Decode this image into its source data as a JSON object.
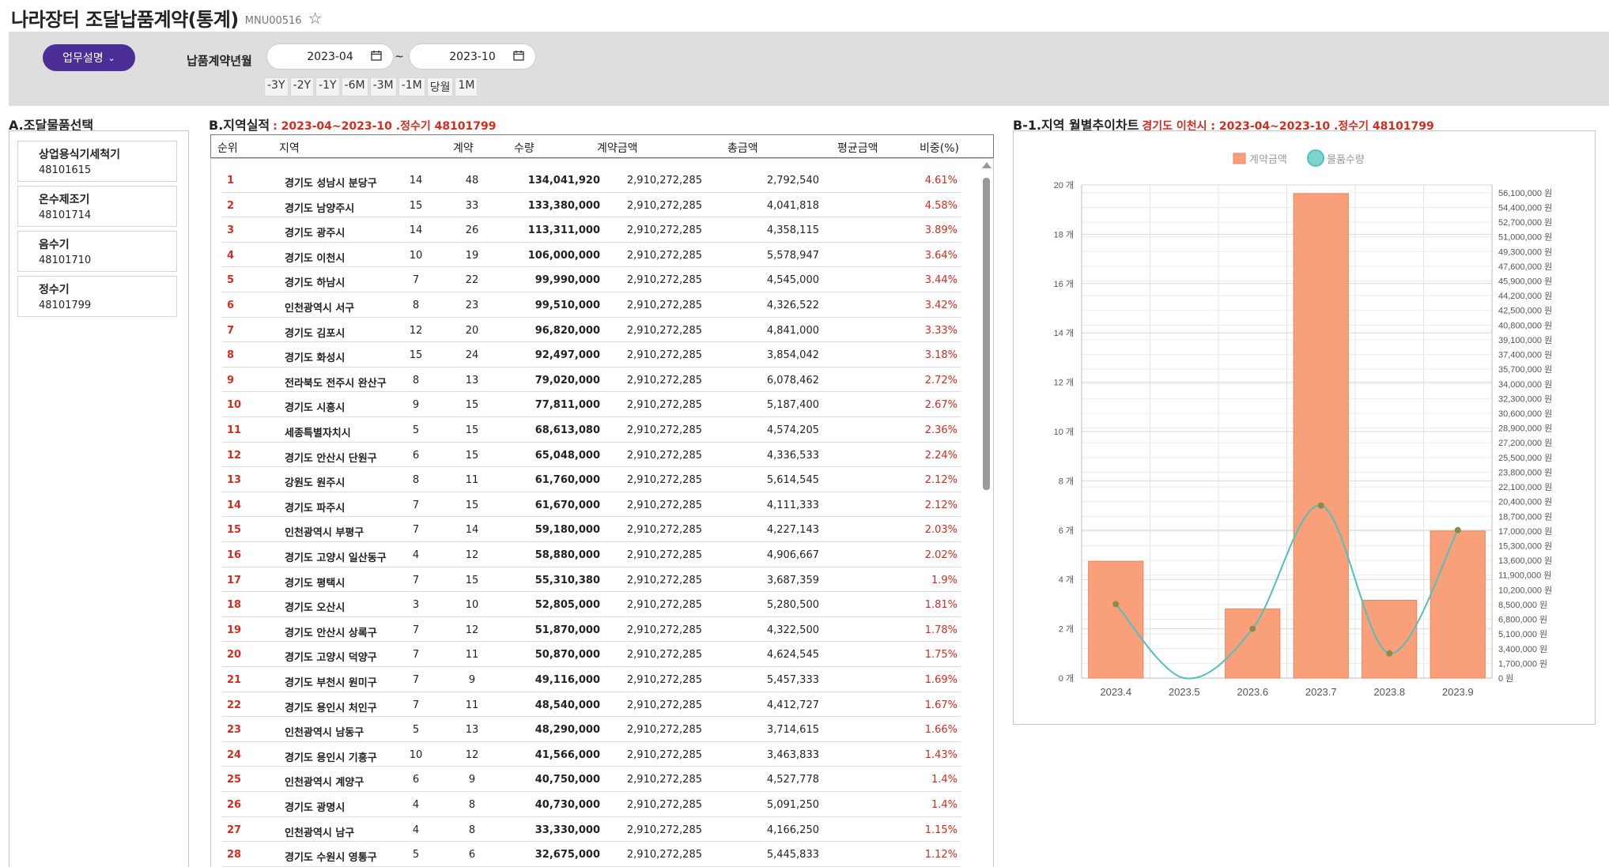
{
  "header": {
    "title": "나라장터 조달납품계약(통계)",
    "code": "MNU00516",
    "star_icon": "star-outline-icon"
  },
  "search": {
    "desc_button": "업무설명",
    "label": "납품계약년월",
    "date_from": "2023-04",
    "date_to": "2023-10",
    "tilde": "~",
    "quick": [
      "-3Y",
      "-2Y",
      "-1Y",
      "-6M",
      "-3M",
      "-1M",
      "당월",
      "1M"
    ]
  },
  "section_a": {
    "title": "A.조달물품선택",
    "items": [
      {
        "name": "상업용식기세척기",
        "code": "48101615"
      },
      {
        "name": "온수제조기",
        "code": "48101714"
      },
      {
        "name": "음수기",
        "code": "48101710"
      },
      {
        "name": "정수기",
        "code": "48101799"
      }
    ]
  },
  "section_b": {
    "title": "B.지역실적",
    "subtitle": ": 2023-04~2023-10 .정수기 48101799",
    "columns": [
      "순위",
      "지역",
      "계약",
      "수량",
      "계약금액",
      "총금액",
      "평균금액",
      "비중(%)"
    ],
    "rows": [
      [
        "1",
        "경기도 성남시 분당구",
        "14",
        "48",
        "134,041,920",
        "2,910,272,285",
        "2,792,540",
        "4.61%"
      ],
      [
        "2",
        "경기도 남양주시",
        "15",
        "33",
        "133,380,000",
        "2,910,272,285",
        "4,041,818",
        "4.58%"
      ],
      [
        "3",
        "경기도 광주시",
        "14",
        "26",
        "113,311,000",
        "2,910,272,285",
        "4,358,115",
        "3.89%"
      ],
      [
        "4",
        "경기도 이천시",
        "10",
        "19",
        "106,000,000",
        "2,910,272,285",
        "5,578,947",
        "3.64%"
      ],
      [
        "5",
        "경기도 하남시",
        "7",
        "22",
        "99,990,000",
        "2,910,272,285",
        "4,545,000",
        "3.44%"
      ],
      [
        "6",
        "인천광역시 서구",
        "8",
        "23",
        "99,510,000",
        "2,910,272,285",
        "4,326,522",
        "3.42%"
      ],
      [
        "7",
        "경기도 김포시",
        "12",
        "20",
        "96,820,000",
        "2,910,272,285",
        "4,841,000",
        "3.33%"
      ],
      [
        "8",
        "경기도 화성시",
        "15",
        "24",
        "92,497,000",
        "2,910,272,285",
        "3,854,042",
        "3.18%"
      ],
      [
        "9",
        "전라북도 전주시 완산구",
        "8",
        "13",
        "79,020,000",
        "2,910,272,285",
        "6,078,462",
        "2.72%"
      ],
      [
        "10",
        "경기도 시흥시",
        "9",
        "15",
        "77,811,000",
        "2,910,272,285",
        "5,187,400",
        "2.67%"
      ],
      [
        "11",
        "세종특별자치시",
        "5",
        "15",
        "68,613,080",
        "2,910,272,285",
        "4,574,205",
        "2.36%"
      ],
      [
        "12",
        "경기도 안산시 단원구",
        "6",
        "15",
        "65,048,000",
        "2,910,272,285",
        "4,336,533",
        "2.24%"
      ],
      [
        "13",
        "강원도 원주시",
        "8",
        "11",
        "61,760,000",
        "2,910,272,285",
        "5,614,545",
        "2.12%"
      ],
      [
        "14",
        "경기도 파주시",
        "7",
        "15",
        "61,670,000",
        "2,910,272,285",
        "4,111,333",
        "2.12%"
      ],
      [
        "15",
        "인천광역시 부평구",
        "7",
        "14",
        "59,180,000",
        "2,910,272,285",
        "4,227,143",
        "2.03%"
      ],
      [
        "16",
        "경기도 고양시 일산동구",
        "4",
        "12",
        "58,880,000",
        "2,910,272,285",
        "4,906,667",
        "2.02%"
      ],
      [
        "17",
        "경기도 평택시",
        "7",
        "15",
        "55,310,380",
        "2,910,272,285",
        "3,687,359",
        "1.9%"
      ],
      [
        "18",
        "경기도 오산시",
        "3",
        "10",
        "52,805,000",
        "2,910,272,285",
        "5,280,500",
        "1.81%"
      ],
      [
        "19",
        "경기도 안산시 상록구",
        "7",
        "12",
        "51,870,000",
        "2,910,272,285",
        "4,322,500",
        "1.78%"
      ],
      [
        "20",
        "경기도 고양시 덕양구",
        "7",
        "11",
        "50,870,000",
        "2,910,272,285",
        "4,624,545",
        "1.75%"
      ],
      [
        "21",
        "경기도 부천시 원미구",
        "7",
        "9",
        "49,116,000",
        "2,910,272,285",
        "5,457,333",
        "1.69%"
      ],
      [
        "22",
        "경기도 용인시 처인구",
        "7",
        "11",
        "48,540,000",
        "2,910,272,285",
        "4,412,727",
        "1.67%"
      ],
      [
        "23",
        "인천광역시 남동구",
        "5",
        "13",
        "48,290,000",
        "2,910,272,285",
        "3,714,615",
        "1.66%"
      ],
      [
        "24",
        "경기도 용인시 기흥구",
        "10",
        "12",
        "41,566,000",
        "2,910,272,285",
        "3,463,833",
        "1.43%"
      ],
      [
        "25",
        "인천광역시 계양구",
        "6",
        "9",
        "40,750,000",
        "2,910,272,285",
        "4,527,778",
        "1.4%"
      ],
      [
        "26",
        "경기도 광명시",
        "4",
        "8",
        "40,730,000",
        "2,910,272,285",
        "5,091,250",
        "1.4%"
      ],
      [
        "27",
        "인천광역시 남구",
        "4",
        "8",
        "33,330,000",
        "2,910,272,285",
        "4,166,250",
        "1.15%"
      ],
      [
        "28",
        "경기도 수원시 영통구",
        "5",
        "6",
        "32,675,000",
        "2,910,272,285",
        "5,445,833",
        "1.12%"
      ]
    ]
  },
  "section_b1": {
    "title": "B-1.지역 월별추이차트",
    "subtitle": "경기도 이천시 : 2023-04~2023-10 .정수기 48101799"
  },
  "chart_data": {
    "type": "bar",
    "categories": [
      "2023.4",
      "2023.5",
      "2023.6",
      "2023.7",
      "2023.8",
      "2023.9"
    ],
    "series": [
      {
        "name": "계약금액",
        "type": "bar",
        "axis": "right",
        "values": [
          13500000,
          0,
          8000000,
          56000000,
          9000000,
          17000000
        ],
        "color": "#f9a07b"
      },
      {
        "name": "물품수량",
        "type": "line",
        "axis": "left",
        "values": [
          3,
          0,
          2,
          7,
          1,
          6
        ],
        "color": "#4fc1bd"
      }
    ],
    "y_left": {
      "min": 0,
      "max": 20,
      "step": 2,
      "unit": "개"
    },
    "y_right": {
      "ticks": [
        "0 원",
        "1,700,000 원",
        "3,400,000 원",
        "5,100,000 원",
        "6,800,000 원",
        "8,500,000 원",
        "10,200,000 원",
        "11,900,000 원",
        "13,600,000 원",
        "15,300,000 원",
        "17,000,000 원",
        "18,700,000 원",
        "20,400,000 원",
        "22,100,000 원",
        "23,800,000 원",
        "25,500,000 원",
        "27,200,000 원",
        "28,900,000 원",
        "30,600,000 원",
        "32,300,000 원",
        "34,000,000 원",
        "35,700,000 원",
        "37,400,000 원",
        "39,100,000 원",
        "40,800,000 원",
        "42,500,000 원",
        "44,200,000 원",
        "45,900,000 원",
        "47,600,000 원",
        "49,300,000 원",
        "51,000,000 원",
        "52,700,000 원",
        "54,400,000 원",
        "56,100,000 원"
      ],
      "max": 57000000
    },
    "legend_position": "top-center",
    "grid": true,
    "line_point_color": "#8a8a4a"
  }
}
